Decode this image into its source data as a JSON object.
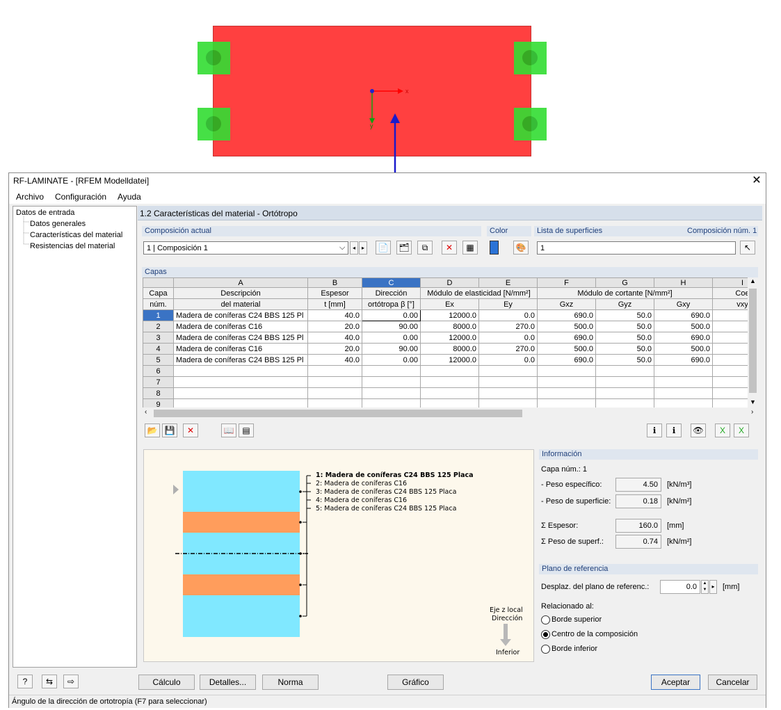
{
  "view3d": {
    "axis_x": "x",
    "axis_y": "y",
    "plate_color": "#ff4040",
    "support_color": "#33dd33",
    "arrow_color": "#1a1acc"
  },
  "window": {
    "title": "RF-LAMINATE - [RFEM Modelldatei]",
    "close_icon": "close-icon"
  },
  "menu": {
    "archivo": "Archivo",
    "configuracion": "Configuración",
    "ayuda": "Ayuda"
  },
  "tree": {
    "root": "Datos de entrada",
    "items": [
      "Datos generales",
      "Características del material",
      "Resistencias del material"
    ]
  },
  "panel": {
    "title": "1.2 Características del material - Ortótropo"
  },
  "composicion": {
    "label": "Composición actual",
    "value": "1 | Composición 1"
  },
  "color": {
    "label": "Color",
    "swatch": "#2b73d6"
  },
  "superficies": {
    "label": "Lista de superficies",
    "comp_num": "Composición núm. 1",
    "value": "1"
  },
  "capas": {
    "label": "Capas",
    "col_letters": [
      "A",
      "B",
      "C",
      "D",
      "E",
      "F",
      "G",
      "H",
      "I"
    ],
    "header_capa": "Capa",
    "header_num": "núm.",
    "h_desc1": "Descripción",
    "h_desc2": "del material",
    "h_esp1": "Espesor",
    "h_esp2": "t [mm]",
    "h_dir1": "Dirección",
    "h_dir2": "ortótropa β [°]",
    "h_mod_e": "Módulo de elasticidad [N/mm²]",
    "h_ex": "Ex",
    "h_ey": "Ey",
    "h_mod_g": "Módulo de cortante [N/mm²]",
    "h_gxz": "Gxz",
    "h_gyz": "Gyz",
    "h_gxy": "Gxy",
    "h_coe": "Coe",
    "h_vxy": "vxy",
    "rows": [
      {
        "n": "1",
        "desc": "Madera de coníferas C24 BBS 125 Pl",
        "t": "40.0",
        "beta": "0.00",
        "ex": "12000.0",
        "ey": "0.0",
        "gxz": "690.0",
        "gyz": "50.0",
        "gxy": "690.0"
      },
      {
        "n": "2",
        "desc": "Madera de coníferas C16",
        "t": "20.0",
        "beta": "90.00",
        "ex": "8000.0",
        "ey": "270.0",
        "gxz": "500.0",
        "gyz": "50.0",
        "gxy": "500.0"
      },
      {
        "n": "3",
        "desc": "Madera de coníferas C24 BBS 125 Pl",
        "t": "40.0",
        "beta": "0.00",
        "ex": "12000.0",
        "ey": "0.0",
        "gxz": "690.0",
        "gyz": "50.0",
        "gxy": "690.0"
      },
      {
        "n": "4",
        "desc": "Madera de coníferas C16",
        "t": "20.0",
        "beta": "90.00",
        "ex": "8000.0",
        "ey": "270.0",
        "gxz": "500.0",
        "gyz": "50.0",
        "gxy": "500.0"
      },
      {
        "n": "5",
        "desc": "Madera de coníferas C24 BBS 125 Pl",
        "t": "40.0",
        "beta": "0.00",
        "ex": "12000.0",
        "ey": "0.0",
        "gxz": "690.0",
        "gyz": "50.0",
        "gxy": "690.0"
      },
      {
        "n": "6"
      },
      {
        "n": "7"
      },
      {
        "n": "8"
      },
      {
        "n": "9"
      }
    ]
  },
  "legend": {
    "lines": [
      "1: Madera de coníferas C24 BBS 125 Placa",
      "2: Madera de coníferas C16",
      "3: Madera de coníferas C24 BBS 125 Placa",
      "4: Madera de coníferas C16",
      "5: Madera de coníferas C24 BBS 125 Placa"
    ],
    "eje1": "Eje z local",
    "eje2": "Dirección",
    "inferior": "Inferior",
    "layer_colors": [
      "#80e8ff",
      "#ff9d5c",
      "#80e8ff",
      "#ff9d5c",
      "#80e8ff"
    ]
  },
  "info": {
    "title": "Información",
    "capa": "Capa núm.: 1",
    "peso_esp": "- Peso específico:",
    "peso_esp_val": "4.50",
    "peso_esp_unit": "[kN/m³]",
    "peso_sup": "- Peso de superficie:",
    "peso_sup_val": "0.18",
    "peso_sup_unit": "[kN/m²]",
    "sum_esp": "Σ Espesor:",
    "sum_esp_val": "160.0",
    "sum_esp_unit": "[mm]",
    "sum_peso": "Σ Peso de superf.:",
    "sum_peso_val": "0.74",
    "sum_peso_unit": "[kN/m²]"
  },
  "plano": {
    "title": "Plano de referencia",
    "desplaz": "Desplaz. del plano de referenc.:",
    "desplaz_val": "0.0",
    "desplaz_unit": "[mm]",
    "rel": "Relacionado al:",
    "opt1": "Borde superior",
    "opt2": "Centro de la composición",
    "opt3": "Borde inferior"
  },
  "buttons": {
    "calculo": "Cálculo",
    "detalles": "Detalles...",
    "norma": "Norma",
    "grafico": "Gráfico",
    "aceptar": "Aceptar",
    "cancelar": "Cancelar"
  },
  "status": "Ángulo de la dirección de ortotropía (F7 para seleccionar)"
}
